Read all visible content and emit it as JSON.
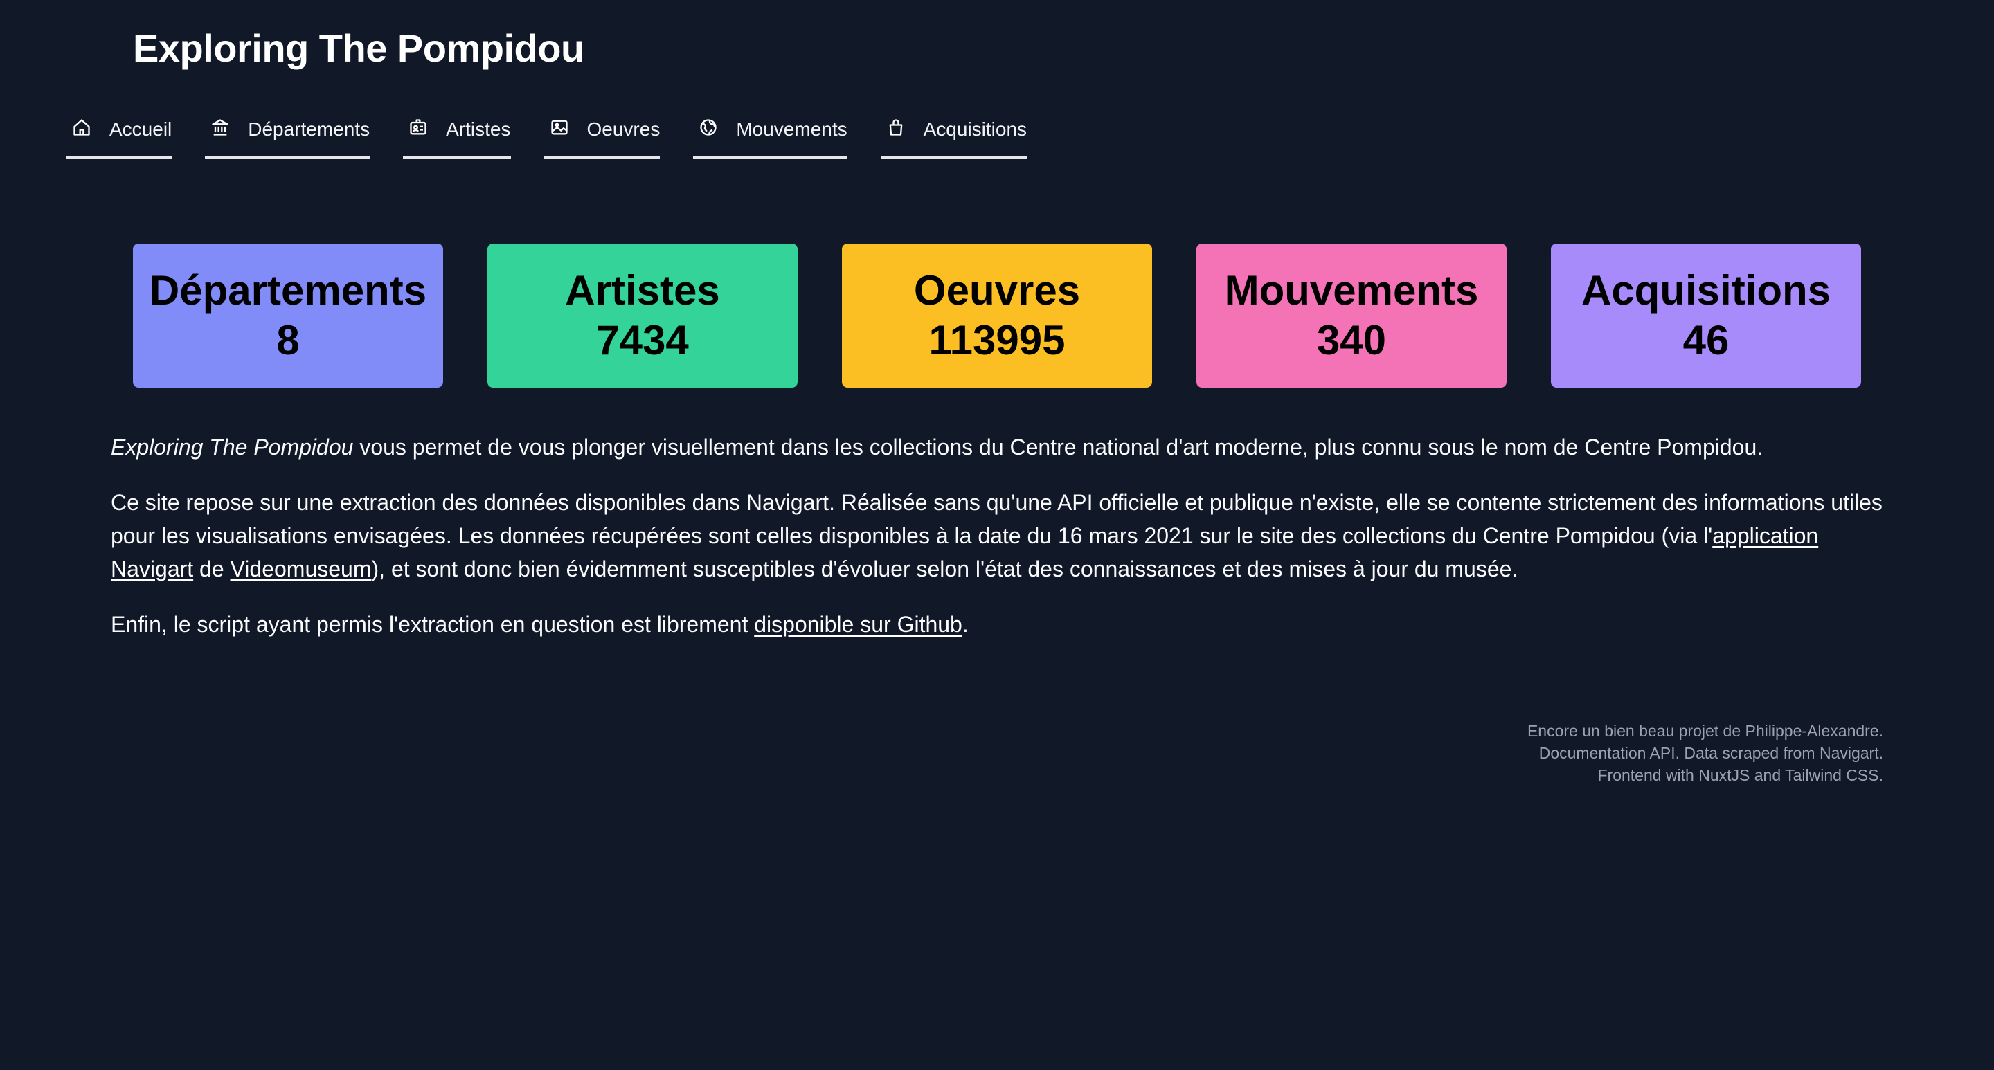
{
  "site_title": "Exploring The Pompidou",
  "nav": [
    {
      "label": "Accueil",
      "icon": "home-icon"
    },
    {
      "label": "Départements",
      "icon": "building-icon"
    },
    {
      "label": "Artistes",
      "icon": "id-card-icon"
    },
    {
      "label": "Oeuvres",
      "icon": "image-icon"
    },
    {
      "label": "Mouvements",
      "icon": "globe-icon"
    },
    {
      "label": "Acquisitions",
      "icon": "shopping-bag-icon"
    }
  ],
  "stats": [
    {
      "label": "Départements",
      "value": "8",
      "color": "#818cf8"
    },
    {
      "label": "Artistes",
      "value": "7434",
      "color": "#34d399"
    },
    {
      "label": "Oeuvres",
      "value": "113995",
      "color": "#fbbf24"
    },
    {
      "label": "Mouvements",
      "value": "340",
      "color": "#f472b6"
    },
    {
      "label": "Acquisitions",
      "value": "46",
      "color": "#a78bfa"
    }
  ],
  "intro": {
    "em": "Exploring The Pompidou",
    "text": " vous permet de vous plonger visuellement dans les collections du Centre national d'art moderne, plus connu sous le nom de Centre Pompidou."
  },
  "para2": {
    "before": "Ce site repose sur une extraction des données disponibles dans Navigart. Réalisée sans qu'une API officielle et publique n'existe, elle se contente strictement des informations utiles pour les visualisations envisagées. Les données récupérées sont celles disponibles à la date du 16 mars 2021 sur le site des collections du Centre Pompidou (via l'",
    "link1": "application Navigart",
    "mid": " de ",
    "link2": "Videomuseum",
    "after": "), et sont donc bien évidemment susceptibles d'évoluer selon l'état des connaissances et des mises à jour du musée."
  },
  "para3": {
    "before": "Enfin, le script ayant permis l'extraction en question est librement ",
    "link": "disponible sur Github",
    "after": "."
  },
  "footer": [
    "Encore un bien beau projet de Philippe-Alexandre.",
    "Documentation API. Data scraped from Navigart.",
    "Frontend with NuxtJS and Tailwind CSS."
  ],
  "colors": {
    "background": "#111827",
    "text": "#ffffff",
    "footer_text": "#9ca3af"
  }
}
